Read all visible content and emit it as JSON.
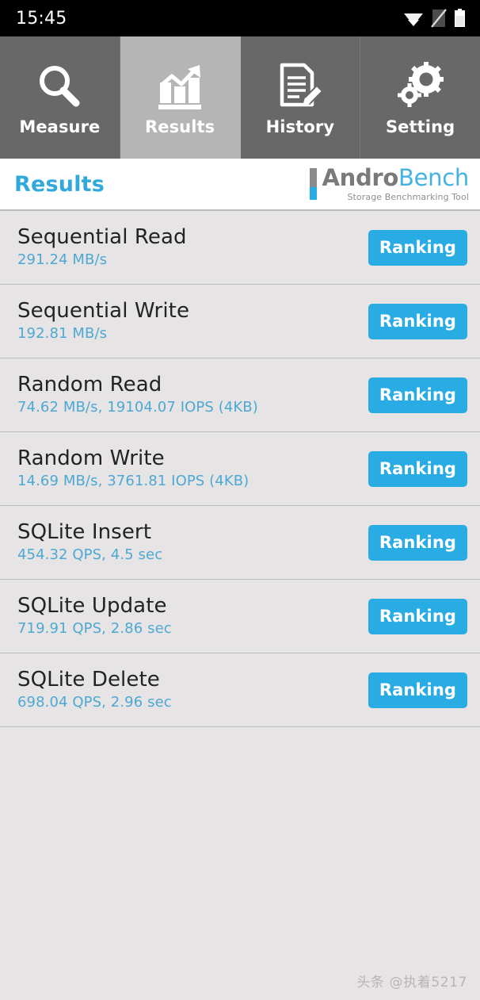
{
  "status_bar": {
    "time": "15:45",
    "icons": [
      {
        "name": "wifi-icon",
        "label": "wifi"
      },
      {
        "name": "no-sim-icon",
        "label": "no-sim"
      },
      {
        "name": "battery-icon",
        "label": "battery"
      }
    ]
  },
  "tabs": [
    {
      "label": "Measure",
      "icon": "magnifier-icon",
      "active": false
    },
    {
      "label": "Results",
      "icon": "bar-chart-arrow-icon",
      "active": true
    },
    {
      "label": "History",
      "icon": "document-pencil-icon",
      "active": false
    },
    {
      "label": "Setting",
      "icon": "gears-icon",
      "active": false
    }
  ],
  "header": {
    "title": "Results",
    "logo": {
      "name_part1": "Andro",
      "name_part2": "Bench",
      "tagline": "Storage Benchmarking Tool"
    }
  },
  "results": [
    {
      "name": "Sequential Read",
      "value": "291.24 MB/s",
      "button": "Ranking"
    },
    {
      "name": "Sequential Write",
      "value": "192.81 MB/s",
      "button": "Ranking"
    },
    {
      "name": "Random Read",
      "value": "74.62 MB/s, 19104.07 IOPS (4KB)",
      "button": "Ranking"
    },
    {
      "name": "Random Write",
      "value": "14.69 MB/s, 3761.81 IOPS (4KB)",
      "button": "Ranking"
    },
    {
      "name": "SQLite Insert",
      "value": "454.32 QPS, 4.5 sec",
      "button": "Ranking"
    },
    {
      "name": "SQLite Update",
      "value": "719.91 QPS, 2.86 sec",
      "button": "Ranking"
    },
    {
      "name": "SQLite Delete",
      "value": "698.04 QPS, 2.96 sec",
      "button": "Ranking"
    }
  ],
  "watermark": {
    "text": "头条 @执着5217"
  },
  "colors": {
    "accent_blue": "#29ace3",
    "title_blue": "#31a9dd",
    "value_blue": "#4da8d4",
    "tab_inactive": "#686868",
    "tab_active": "#b5b5b5",
    "list_background": "#e6e4e4",
    "status_bar": "#000000"
  }
}
